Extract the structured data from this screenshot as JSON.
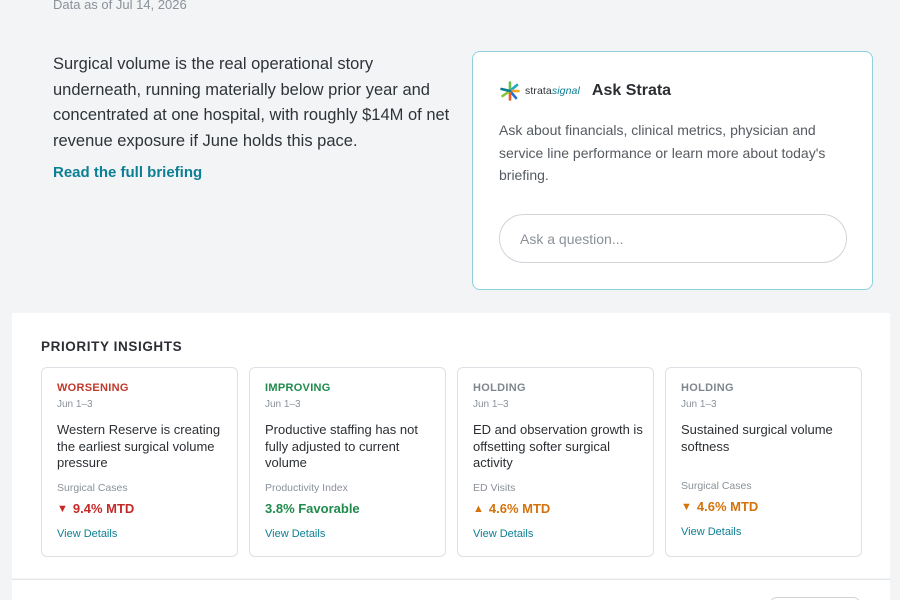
{
  "header": {
    "data_as_of": "Data as of Jul 14, 2026"
  },
  "briefing": {
    "summary": "Surgical volume is the real operational story underneath, running materially below prior year and concentrated at one hospital, with roughly $14M of net revenue exposure if June holds this pace.",
    "read_link": "Read the full briefing"
  },
  "ask": {
    "logo_prefix": "strata",
    "logo_suffix": "signal",
    "title": "Ask Strata",
    "description": "Ask about financials, clinical metrics, physician and service line performance or learn more about today's briefing.",
    "placeholder": "Ask a question..."
  },
  "insights": {
    "title": "PRIORITY INSIGHTS",
    "cards": [
      {
        "status": "WORSENING",
        "date": "Jun 1–3",
        "headline": "Western Reserve is creating the earliest surgical volume pressure",
        "metric": "Surgical Cases",
        "arrow": "▼",
        "value": "9.4% MTD",
        "details": "View Details"
      },
      {
        "status": "IMPROVING",
        "date": "Jun 1–3",
        "headline": "Productive staffing has not fully adjusted to current volume",
        "metric": "Productivity Index",
        "arrow": "",
        "value": "3.8% Favorable",
        "details": "View Details"
      },
      {
        "status": "HOLDING",
        "date": "Jun 1–3",
        "headline": "ED and observation growth is offsetting softer surgical activity",
        "metric": "ED Visits",
        "arrow": "▲",
        "value": "4.6% MTD",
        "details": "View Details"
      },
      {
        "status": "HOLDING",
        "date": "Jun 1–3",
        "headline": "Sustained surgical volume softness",
        "metric": "Surgical Cases",
        "arrow": "▼",
        "value": "4.6% MTD",
        "details": "View Details"
      }
    ]
  },
  "colors": {
    "accent": "#0d7f94",
    "worsening": "#c0392b",
    "improving": "#1f8a4c",
    "holding": "#7f868d",
    "down_red": "#c62828",
    "up_orange": "#d4720b"
  }
}
